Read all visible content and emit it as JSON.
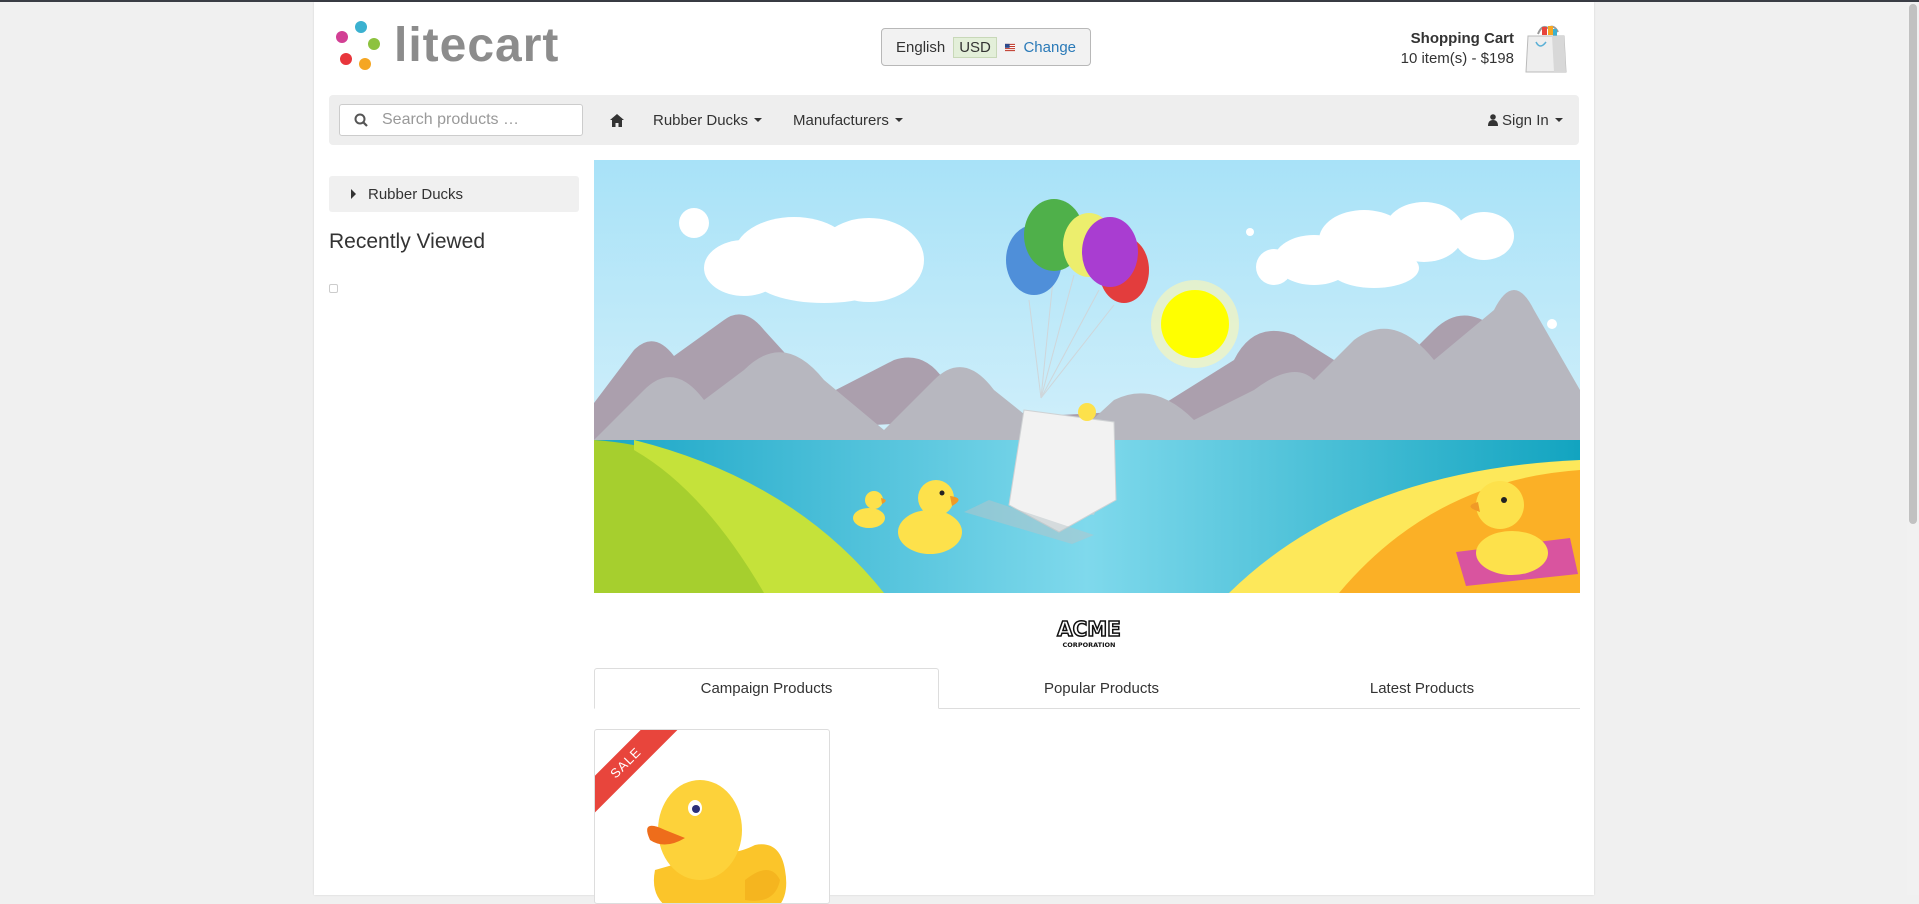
{
  "header": {
    "logo_text": "litecart",
    "region": {
      "language": "English",
      "currency": "USD",
      "change_label": "Change"
    },
    "cart": {
      "title": "Shopping Cart",
      "summary": "10 item(s) - $198"
    }
  },
  "nav": {
    "search_placeholder": "Search products …",
    "menu": [
      {
        "label": "Rubber Ducks"
      },
      {
        "label": "Manufacturers"
      }
    ],
    "sign_in_label": "Sign In"
  },
  "sidebar": {
    "category": "Rubber Ducks",
    "recently_viewed_title": "Recently Viewed"
  },
  "manufacturer_logo": {
    "line1": "ACME",
    "line2": "CORPORATION"
  },
  "tabs": [
    {
      "label": "Campaign Products",
      "active": true
    },
    {
      "label": "Popular Products",
      "active": false
    },
    {
      "label": "Latest Products",
      "active": false
    }
  ],
  "product": {
    "badge": "SALE"
  },
  "colors": {
    "link": "#2a7ab8",
    "sale": "#e8453c",
    "sky": "#aee3f7",
    "water": "#22b2cc"
  }
}
